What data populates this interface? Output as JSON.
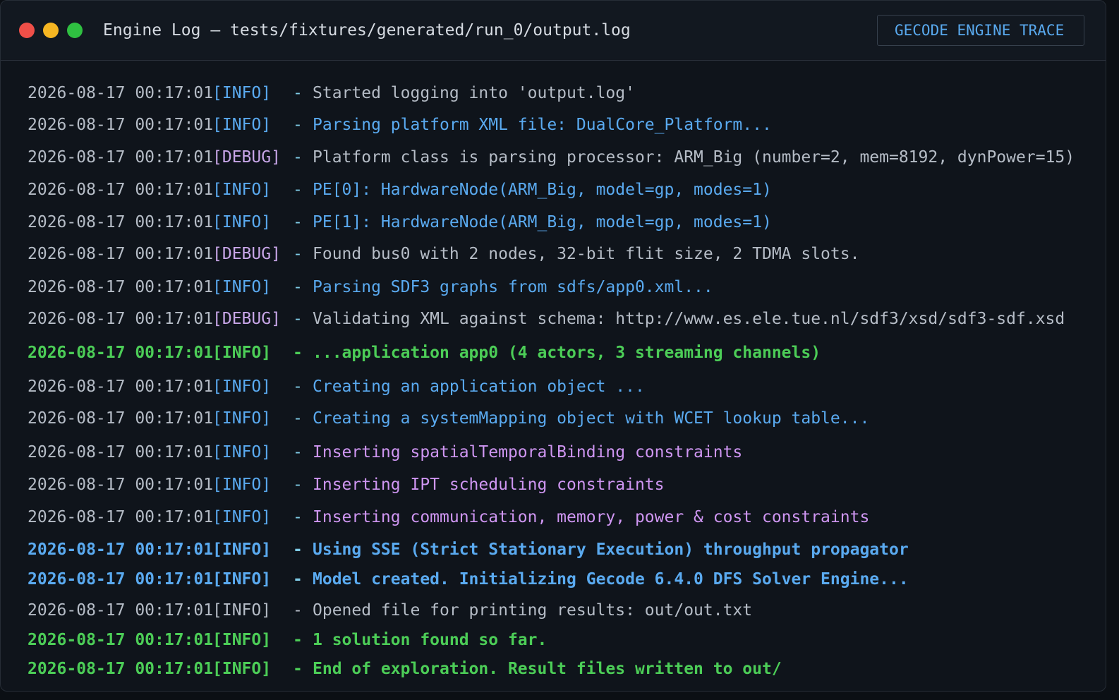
{
  "window": {
    "title": "Engine Log — tests/fixtures/generated/run_0/output.log",
    "badge": "GECODE ENGINE TRACE"
  },
  "colors": {
    "timestamp": "#b5bcc6",
    "info_level": "#5aaaf0",
    "debug_level": "#c8a6e8",
    "dash": "#7fcbe6",
    "blue": "#5aaaf0",
    "purple": "#cf96f2",
    "gray": "#b5bcc6",
    "green": "#4ccd57"
  },
  "log": [
    {
      "ts": "2026-08-17 00:17:01",
      "level": "[INFO]",
      "message": "Started logging into 'output.log'",
      "kind": "gray"
    },
    {
      "ts": "2026-08-17 00:17:01",
      "level": "[INFO]",
      "message": "Parsing platform XML file: DualCore_Platform...",
      "kind": "blue"
    },
    {
      "ts": "2026-08-17 00:17:01",
      "level": "[DEBUG]",
      "message": "Platform class is parsing processor: ARM_Big (number=2, mem=8192, dynPower=15)",
      "kind": "gray"
    },
    {
      "ts": "2026-08-17 00:17:01",
      "level": "[INFO]",
      "message": "PE[0]: HardwareNode(ARM_Big, model=gp, modes=1)",
      "kind": "blue"
    },
    {
      "ts": "2026-08-17 00:17:01",
      "level": "[INFO]",
      "message": "PE[1]: HardwareNode(ARM_Big, model=gp, modes=1)",
      "kind": "blue"
    },
    {
      "ts": "2026-08-17 00:17:01",
      "level": "[DEBUG]",
      "message": "Found bus0 with 2 nodes, 32-bit flit size, 2 TDMA slots.",
      "kind": "gray"
    },
    {
      "ts": "2026-08-17 00:17:01",
      "level": "[INFO]",
      "message": "Parsing SDF3 graphs from sdfs/app0.xml...",
      "kind": "blue"
    },
    {
      "ts": "2026-08-17 00:17:01",
      "level": "[DEBUG]",
      "message": "Validating XML against schema: http://www.es.ele.tue.nl/sdf3/xsd/sdf3-sdf.xsd",
      "kind": "gray"
    },
    {
      "ts": "2026-08-17 00:17:01",
      "level": "[INFO]",
      "message": "...application app0 (4 actors, 3 streaming channels)",
      "kind": "green-bold"
    },
    {
      "ts": "2026-08-17 00:17:01",
      "level": "[INFO]",
      "message": "Creating an application object ...",
      "kind": "blue"
    },
    {
      "ts": "2026-08-17 00:17:01",
      "level": "[INFO]",
      "message": "Creating a systemMapping object with WCET lookup table...",
      "kind": "blue"
    },
    {
      "ts": "2026-08-17 00:17:01",
      "level": "[INFO]",
      "message": "Inserting spatialTemporalBinding constraints",
      "kind": "purple"
    },
    {
      "ts": "2026-08-17 00:17:01",
      "level": "[INFO]",
      "message": "Inserting IPT scheduling constraints",
      "kind": "purple"
    },
    {
      "ts": "2026-08-17 00:17:01",
      "level": "[INFO]",
      "message": "Inserting communication, memory, power & cost constraints",
      "kind": "purple"
    },
    {
      "ts": "2026-08-17 00:17:01",
      "level": "[INFO]",
      "message": "Using SSE (Strict Stationary Execution) throughput propagator",
      "kind": "blue-bold"
    },
    {
      "ts": "2026-08-17 00:17:01",
      "level": "[INFO]",
      "message": "Model created. Initializing Gecode 6.4.0 DFS Solver Engine...",
      "kind": "blue-bold"
    },
    {
      "ts": "2026-08-17 00:17:01",
      "level": "[INFO]",
      "message": "Opened file for printing results: out/out.txt",
      "kind": "plain"
    },
    {
      "ts": "2026-08-17 00:17:01",
      "level": "[INFO]",
      "message": "1 solution found so far.",
      "kind": "green-bold"
    },
    {
      "ts": "2026-08-17 00:17:01",
      "level": "[INFO]",
      "message": "End of exploration. Result files written to out/",
      "kind": "green-bold"
    }
  ]
}
